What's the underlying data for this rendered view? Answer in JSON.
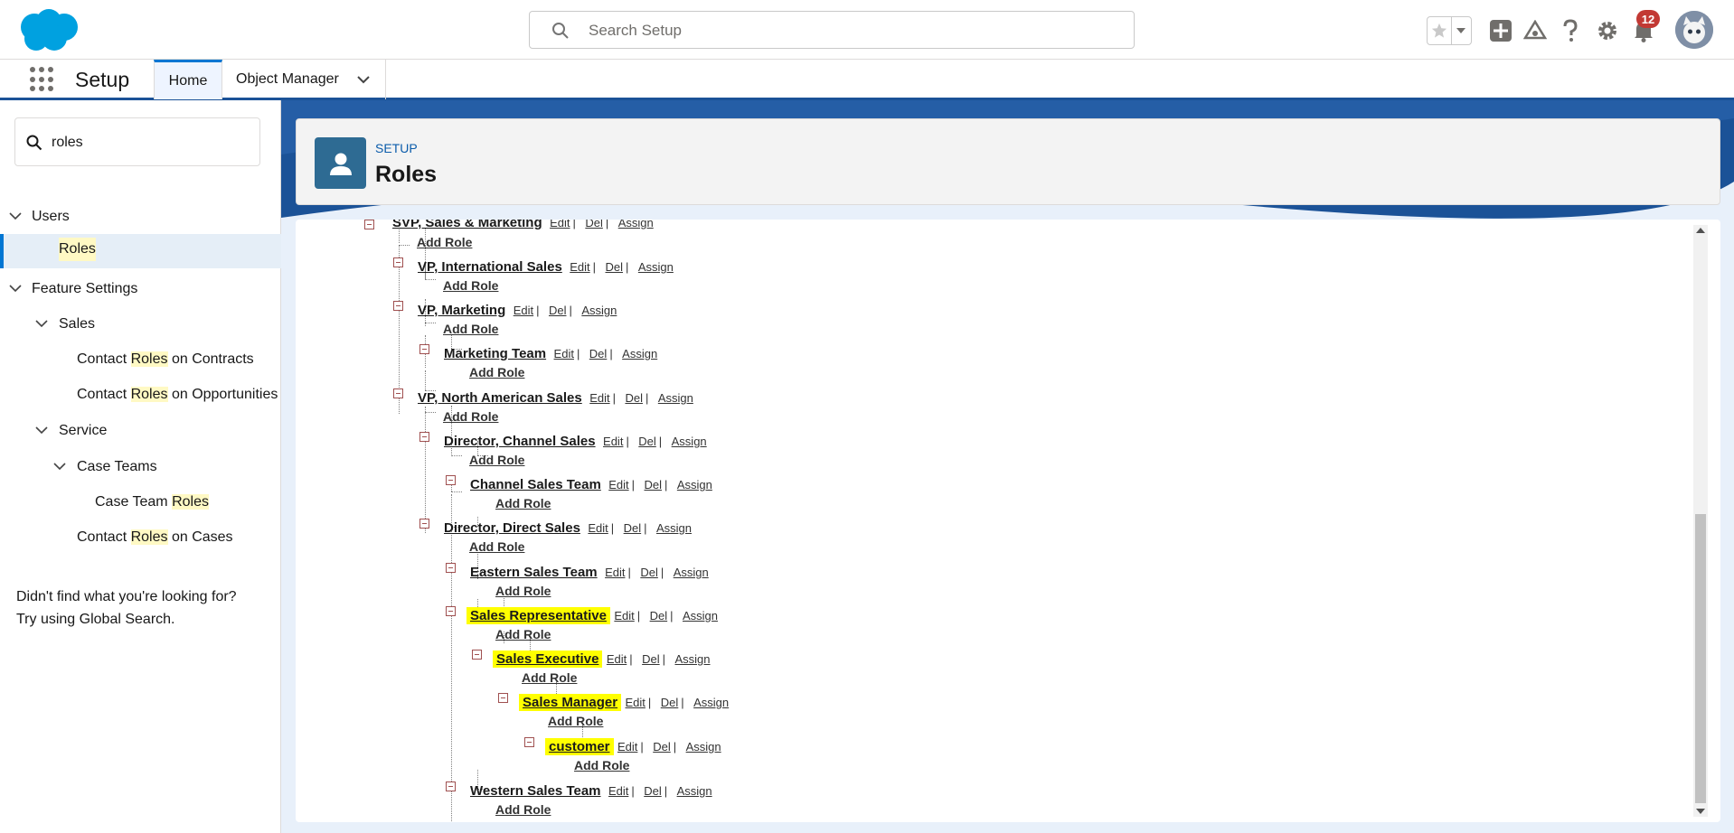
{
  "global_header": {
    "search_placeholder": "Search Setup",
    "notification_count": "12"
  },
  "context_bar": {
    "app_name": "Setup",
    "tabs": {
      "home": "Home",
      "object_manager": "Object Manager"
    }
  },
  "sidebar": {
    "quickfind_value": "roles",
    "items": {
      "users": "Users",
      "roles": "Roles",
      "feature_settings": "Feature Settings",
      "sales": "Sales",
      "contact_roles_contracts_pre": "Contact ",
      "contact_roles_contracts_hl": "Roles",
      "contact_roles_contracts_post": " on Contracts",
      "contact_roles_opps_pre": "Contact ",
      "contact_roles_opps_hl": "Roles",
      "contact_roles_opps_post": " on Opportunities",
      "service": "Service",
      "case_teams": "Case Teams",
      "case_team_roles_pre": "Case Team ",
      "case_team_roles_hl": "Roles",
      "contact_roles_cases_pre": "Contact ",
      "contact_roles_cases_hl": "Roles",
      "contact_roles_cases_post": " on Cases"
    },
    "hint_line1": "Didn't find what you're looking for?",
    "hint_line2": "Try using Global Search."
  },
  "page_header": {
    "breadcrumb": "SETUP",
    "title": "Roles"
  },
  "actions": {
    "edit": "Edit",
    "del": "Del",
    "assign": "Assign",
    "sep": "|",
    "add_role": "Add Role"
  },
  "hierarchy": [
    {
      "name": "SVP, Sales & Marketing",
      "highlighted": false
    },
    {
      "name": "VP, International Sales",
      "highlighted": false
    },
    {
      "name": "VP, Marketing",
      "highlighted": false
    },
    {
      "name": "Marketing Team",
      "highlighted": false
    },
    {
      "name": "VP, North American Sales",
      "highlighted": false
    },
    {
      "name": "Director, Channel Sales",
      "highlighted": false
    },
    {
      "name": "Channel Sales Team",
      "highlighted": false
    },
    {
      "name": "Director, Direct Sales",
      "highlighted": false
    },
    {
      "name": "Eastern Sales Team",
      "highlighted": false
    },
    {
      "name": "Sales Representative",
      "highlighted": true
    },
    {
      "name": "Sales Executive",
      "highlighted": true
    },
    {
      "name": "Sales Manager",
      "highlighted": true
    },
    {
      "name": "customer",
      "highlighted": true
    },
    {
      "name": "Western Sales Team",
      "highlighted": false
    }
  ]
}
